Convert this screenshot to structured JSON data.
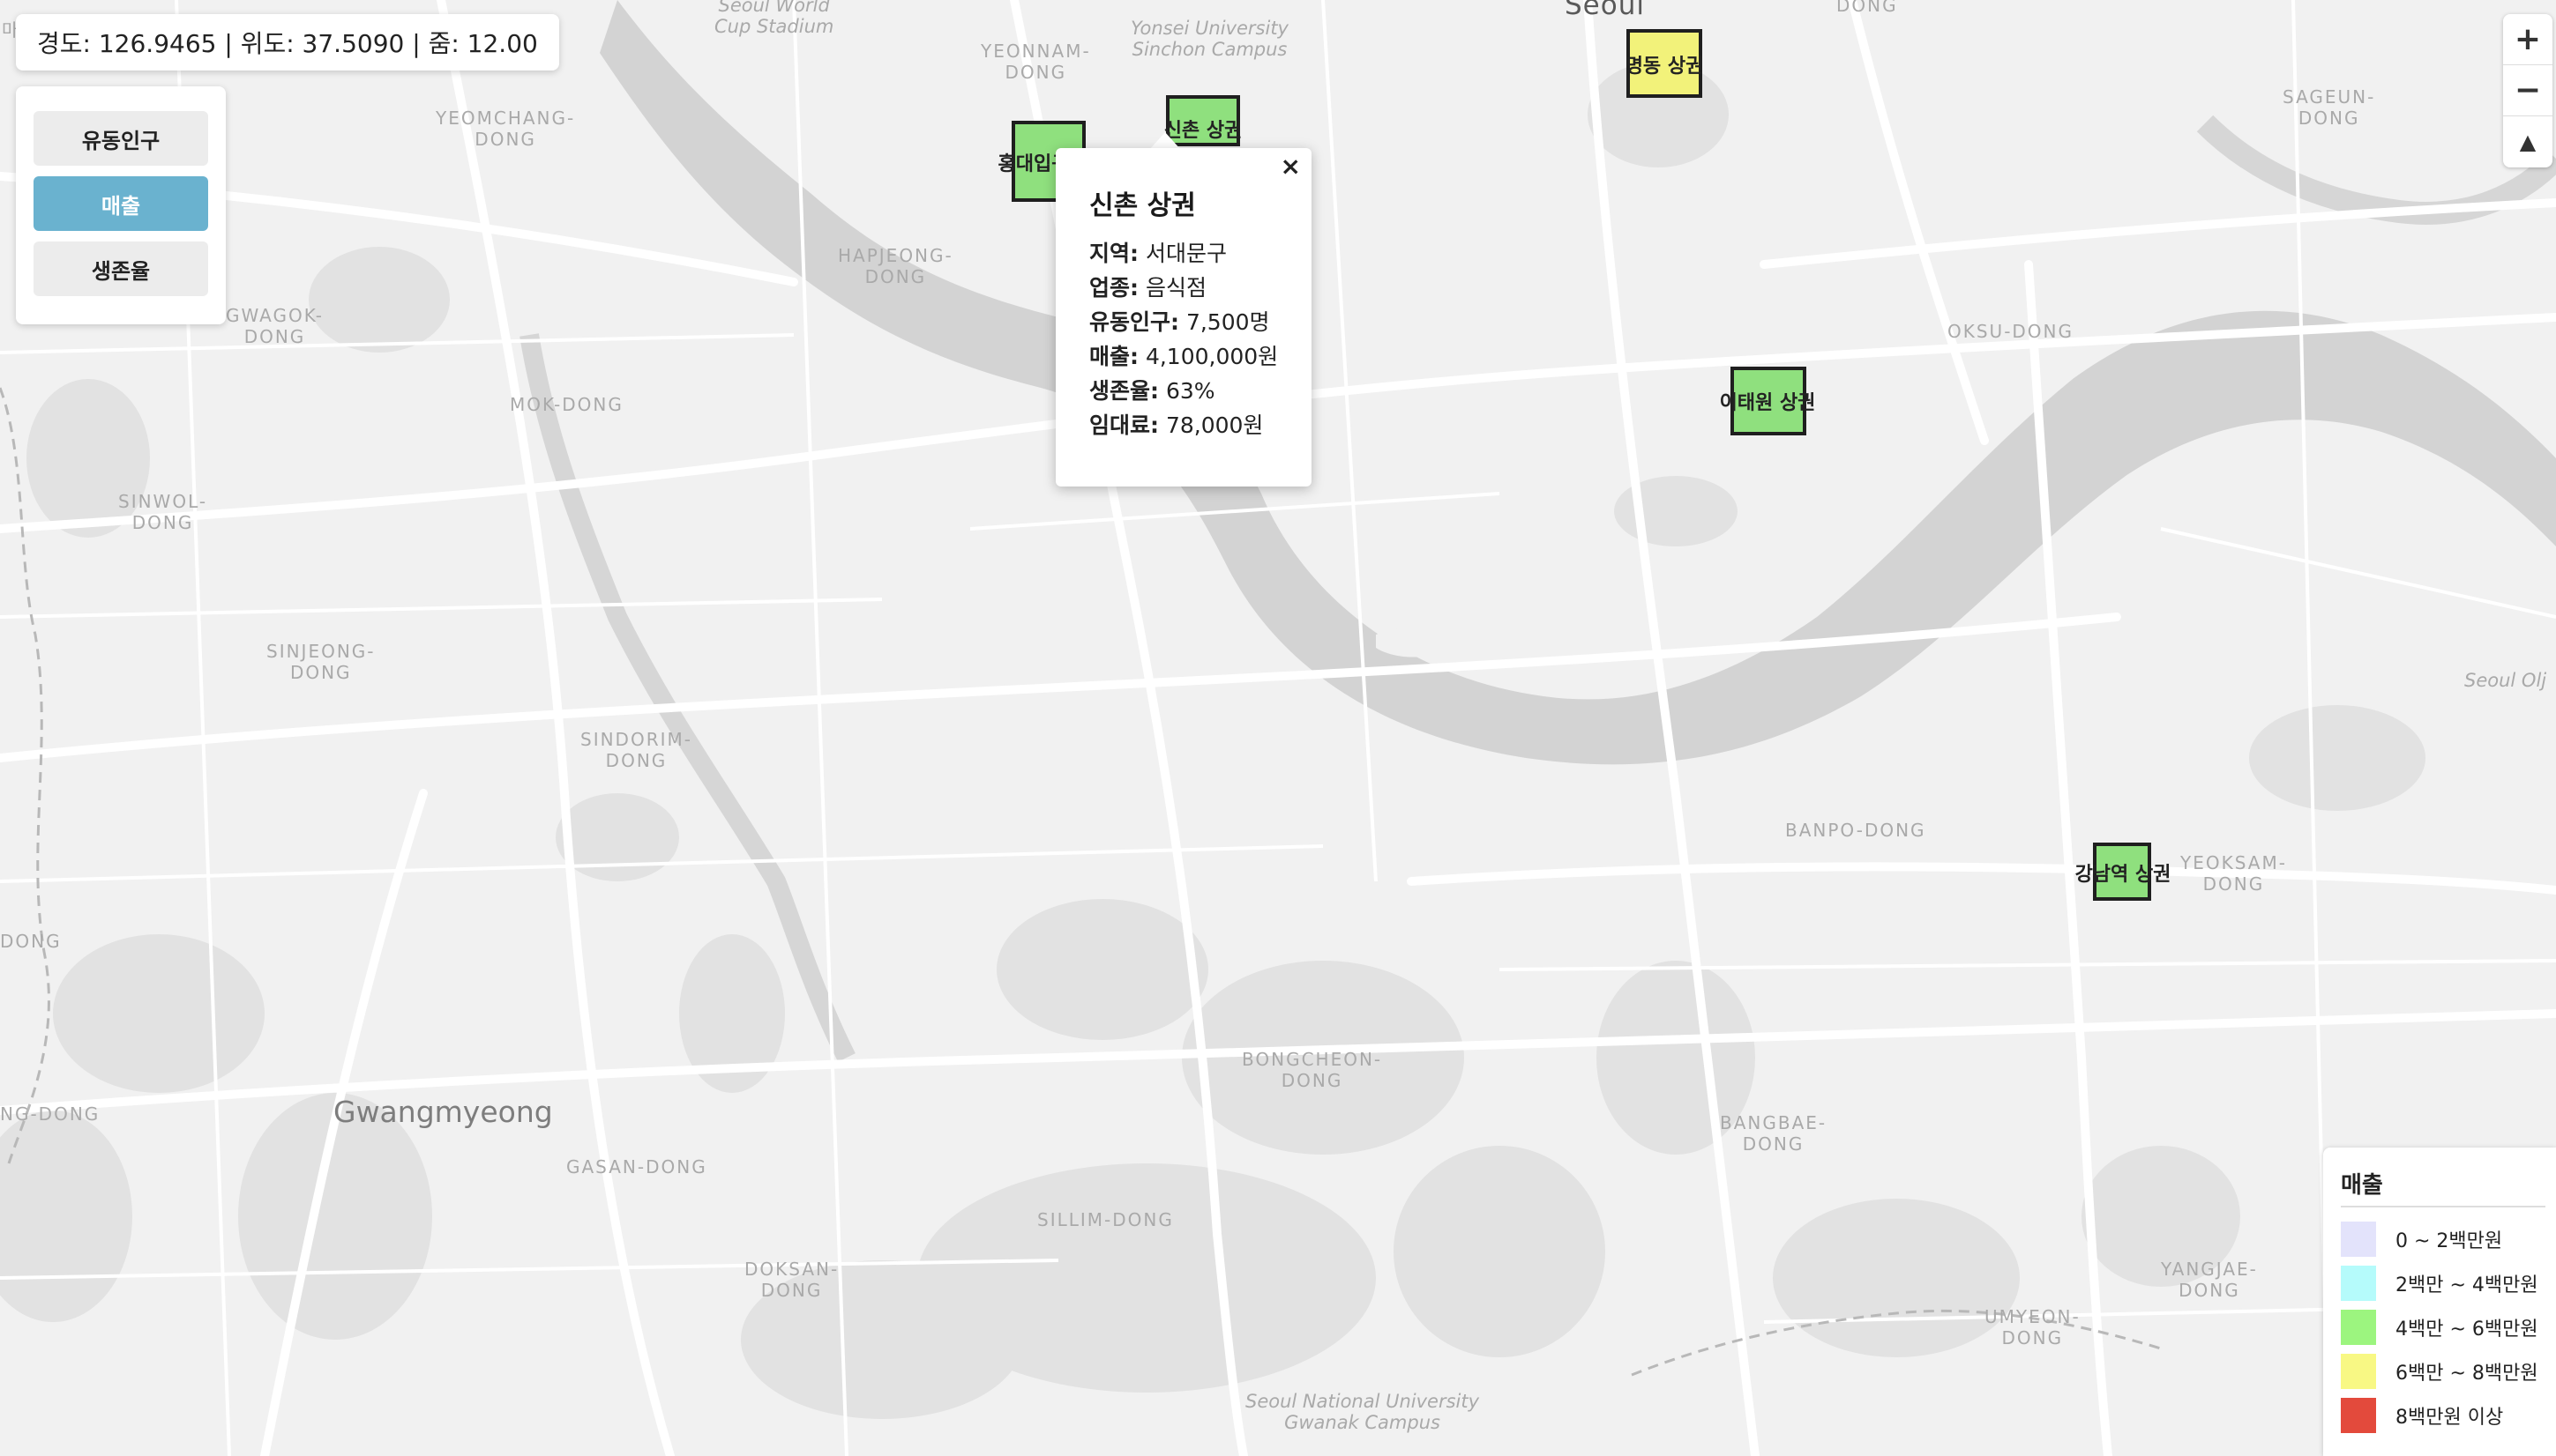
{
  "coords": {
    "text": "경도: 126.9465 | 위도: 37.5090 | 줌: 12.00"
  },
  "layers": {
    "items": [
      {
        "label": "유동인구",
        "active": false
      },
      {
        "label": "매출",
        "active": true
      },
      {
        "label": "생존율",
        "active": false
      }
    ]
  },
  "zoom": {
    "in_icon": "plus-icon",
    "out_icon": "minus-icon",
    "compass_icon": "compass-icon",
    "in": "+",
    "out": "−",
    "compass": "▲"
  },
  "map": {
    "places": [
      {
        "name": "Seoul World\nCup Stadium",
        "kind": "campus"
      },
      {
        "name": "YEONNAM-\nDONG",
        "kind": "area"
      },
      {
        "name": "Yonsei University\nSinchon Campus",
        "kind": "campus"
      },
      {
        "name": "Seoul",
        "kind": "city"
      },
      {
        "name": "SAGEUN-\nDONG",
        "kind": "area"
      },
      {
        "name": "YEOMCHANG-\nDONG",
        "kind": "area"
      },
      {
        "name": "HAPJEONG-\nDONG",
        "kind": "area"
      },
      {
        "name": "GWAGOK-\nDONG",
        "kind": "area"
      },
      {
        "name": "MOK-DONG",
        "kind": "area"
      },
      {
        "name": "OKSU-DONG",
        "kind": "area"
      },
      {
        "name": "SINWOL-\nDONG",
        "kind": "area"
      },
      {
        "name": "SINJEONG-\nDONG",
        "kind": "area"
      },
      {
        "name": "SINDORIM-\nDONG",
        "kind": "area"
      },
      {
        "name": "BANPO-DONG",
        "kind": "area"
      },
      {
        "name": "YEOKSAM-\nDONG",
        "kind": "area"
      },
      {
        "name": "BONGCHEON-\nDONG",
        "kind": "area"
      },
      {
        "name": "BANGBAE-\nDONG",
        "kind": "area"
      },
      {
        "name": "Gwangmyeong",
        "kind": "big"
      },
      {
        "name": "GASAN-DONG",
        "kind": "area"
      },
      {
        "name": "SILLIM-DONG",
        "kind": "area"
      },
      {
        "name": "DOKSAN-\nDONG",
        "kind": "area"
      },
      {
        "name": "YANGJAE-\nDONG",
        "kind": "area"
      },
      {
        "name": "UMYEON-\nDONG",
        "kind": "area"
      },
      {
        "name": "Seoul National University\nGwanak Campus",
        "kind": "campus"
      },
      {
        "name": "NG-DONG",
        "kind": "area"
      },
      {
        "name": "DONG",
        "kind": "area"
      },
      {
        "name": "Seoul Olj",
        "kind": "campus"
      },
      {
        "name": "DONG",
        "kind": "area"
      },
      {
        "name": "마",
        "kind": "area"
      }
    ],
    "markers": [
      {
        "label": "홍대입구",
        "sales_band": "4백만 ~ 6백만원",
        "color": "#8fe07e"
      },
      {
        "label": "신촌 상권",
        "sales_band": "4백만 ~ 6백만원",
        "color": "#8fe07e"
      },
      {
        "label": "명동 상권",
        "sales_band": "6백만 ~ 8백만원",
        "color": "#f2f27a"
      },
      {
        "label": "이태원 상권",
        "sales_band": "4백만 ~ 6백만원",
        "color": "#8fe07e"
      },
      {
        "label": "강남역 상권",
        "sales_band": "4백만 ~ 6백만원",
        "color": "#8fe07e"
      }
    ]
  },
  "popup": {
    "close": "×",
    "title": "신촌 상권",
    "rows": [
      {
        "key": "지역:",
        "value": "서대문구"
      },
      {
        "key": "업종:",
        "value": "음식점"
      },
      {
        "key": "유동인구:",
        "value": "7,500명"
      },
      {
        "key": "매출:",
        "value": "4,100,000원"
      },
      {
        "key": "생존율:",
        "value": "63%"
      },
      {
        "key": "임대료:",
        "value": "78,000원"
      }
    ]
  },
  "legend": {
    "title": "매출",
    "items": [
      {
        "label": "0 ~ 2백만원",
        "color": "#e3e3fb"
      },
      {
        "label": "2백만 ~ 4백만원",
        "color": "#b5fbfb"
      },
      {
        "label": "4백만 ~ 6백만원",
        "color": "#9cf57f"
      },
      {
        "label": "6백만 ~ 8백만원",
        "color": "#f8f884"
      },
      {
        "label": "8백만원 이상",
        "color": "#e34a3c"
      }
    ]
  }
}
